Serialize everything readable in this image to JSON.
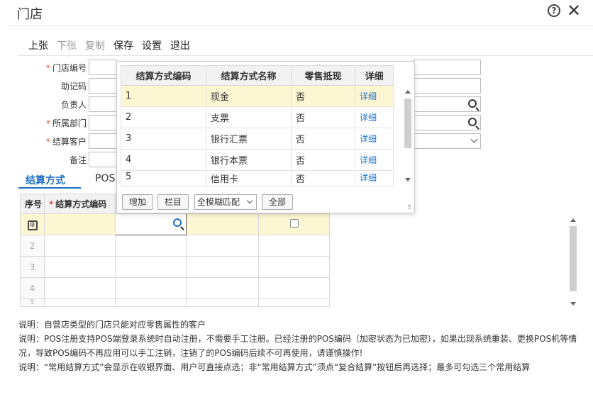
{
  "window": {
    "title": "门店"
  },
  "toolbar": {
    "prev_label": "上张",
    "next_label": "下张",
    "copy_label": "复制",
    "save_label": "保存",
    "settings_label": "设置",
    "exit_label": "退出"
  },
  "form": {
    "store_code_label": "门店编号",
    "mnemonic_label": "助记码",
    "manager_label": "负责人",
    "department_label": "所属部门",
    "settlement_customer_label": "结算客户",
    "remark_label": "备注"
  },
  "tabs": [
    {
      "label": "结算方式"
    },
    {
      "label": "POS"
    }
  ],
  "grid": {
    "headers": [
      "序号",
      "结算方式编码"
    ],
    "row_numbers": [
      "2",
      "3",
      "4",
      "5"
    ]
  },
  "popup": {
    "headers": [
      "结算方式编码",
      "结算方式名称",
      "零售抵现",
      "详细"
    ],
    "rows": [
      {
        "code": "1",
        "name": "现金",
        "offset": "否",
        "detail": "详细"
      },
      {
        "code": "2",
        "name": "支票",
        "offset": "否",
        "detail": "详细"
      },
      {
        "code": "3",
        "name": "银行汇票",
        "offset": "否",
        "detail": "详细"
      },
      {
        "code": "4",
        "name": "银行本票",
        "offset": "否",
        "detail": "详细"
      },
      {
        "code": "5",
        "name": "信用卡",
        "offset": "否",
        "detail": "详细"
      }
    ],
    "add_label": "增加",
    "columns_label": "栏目",
    "match_select": "全模糊匹配",
    "all_label": "全部"
  },
  "notes": [
    "说明：自营店类型的门店只能对应零售属性的客户",
    "说明：POS注册支持POS端登录系统时自动注册，不需要手工注册。已经注册的POS编码（加密状态为已加密），如果出现系统重装、更换POS机等情况，导致POS编码不再应用可以手工注销，注销了的POS编码后续不可再使用，请谨慎操作!",
    "说明：“常用结算方式”会显示在收银界面、用户可直接点选；非“常用结算方式”须点“复合结算”按钮后再选择；最多可勾选三个常用结算"
  ],
  "colors": {
    "accent": "#1e70c7",
    "required": "#d9534f",
    "row_highlight": "#fdf6d3"
  }
}
